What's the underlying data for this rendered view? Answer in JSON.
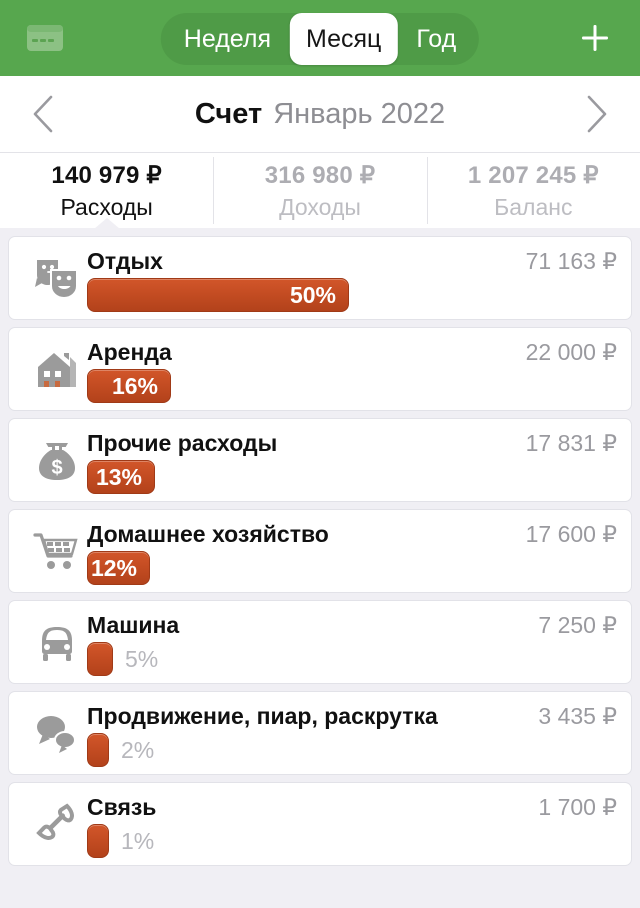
{
  "topbar": {
    "card_icon": "credit-card-icon",
    "add_icon": "plus-icon",
    "segments": [
      {
        "label": "Неделя",
        "active": false
      },
      {
        "label": "Месяц",
        "active": true
      },
      {
        "label": "Год",
        "active": false
      }
    ],
    "background_color": "#57a74e"
  },
  "datebar": {
    "prev_icon": "chevron-left-icon",
    "next_icon": "chevron-right-icon",
    "title": "Счет",
    "period": "Январь 2022"
  },
  "summary": {
    "columns": [
      {
        "value": "140 979 ₽",
        "label": "Расходы",
        "active": true
      },
      {
        "value": "316 980 ₽",
        "label": "Доходы",
        "active": false
      },
      {
        "value": "1 207 245 ₽",
        "label": "Баланс",
        "active": false
      }
    ]
  },
  "accent_color": "#c34c22",
  "chart_data": {
    "type": "bar",
    "title": "Расходы — Январь 2022",
    "orientation": "horizontal",
    "value_unit": "₽",
    "categories": [
      "Отдых",
      "Аренда",
      "Прочие расходы",
      "Домашнее хозяйство",
      "Машина",
      "Продвижение, пиар, раскрутка",
      "Связь"
    ],
    "values": [
      71163,
      22000,
      17831,
      17600,
      7250,
      3435,
      1700
    ],
    "percents": [
      50,
      16,
      13,
      12,
      5,
      2,
      1
    ],
    "total": 140979,
    "xlabel": "",
    "ylabel": "",
    "grid": false,
    "legend": false
  },
  "rows": [
    {
      "icon": "theater-masks-icon",
      "name": "Отдых",
      "amount": "71 163 ₽",
      "percent_label": "50%",
      "percent": 50,
      "label_inside": true
    },
    {
      "icon": "house-icon",
      "name": "Аренда",
      "amount": "22 000 ₽",
      "percent_label": "16%",
      "percent": 16,
      "label_inside": true
    },
    {
      "icon": "money-bag-icon",
      "name": "Прочие расходы",
      "amount": "17 831 ₽",
      "percent_label": "13%",
      "percent": 13,
      "label_inside": true
    },
    {
      "icon": "shopping-cart-icon",
      "name": "Домашнее хозяйство",
      "amount": "17 600 ₽",
      "percent_label": "12%",
      "percent": 12,
      "label_inside": true
    },
    {
      "icon": "car-icon",
      "name": "Машина",
      "amount": "7 250 ₽",
      "percent_label": "5%",
      "percent": 5,
      "label_inside": false
    },
    {
      "icon": "speech-bubbles-icon",
      "name": "Продвижение, пиар, раскрутка",
      "amount": "3 435 ₽",
      "percent_label": "2%",
      "percent": 2,
      "label_inside": false
    },
    {
      "icon": "phone-handset-icon",
      "name": "Связь",
      "amount": "1 700 ₽",
      "percent_label": "1%",
      "percent": 1,
      "label_inside": false
    }
  ]
}
